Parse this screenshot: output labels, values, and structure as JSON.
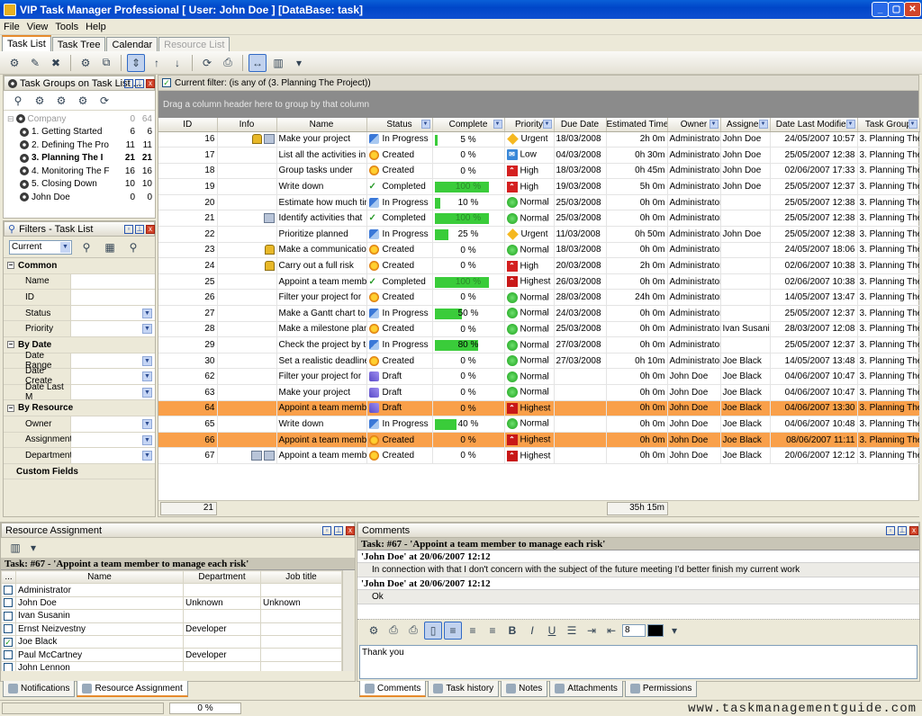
{
  "window": {
    "title": "VIP Task Manager Professional [ User: John Doe ] [DataBase: task]"
  },
  "menu": [
    "File",
    "View",
    "Tools",
    "Help"
  ],
  "tabs": [
    {
      "label": "Task List",
      "active": true
    },
    {
      "label": "Task Tree"
    },
    {
      "label": "Calendar"
    },
    {
      "label": "Resource List",
      "disabled": true
    }
  ],
  "task_groups": {
    "title": "Task Groups on Task List ...",
    "items": [
      {
        "label": "Company",
        "n1": "0",
        "n2": "64",
        "muted": true
      },
      {
        "label": "1. Getting Started",
        "n1": "6",
        "n2": "6"
      },
      {
        "label": "2. Defining The Pro",
        "n1": "11",
        "n2": "11"
      },
      {
        "label": "3. Planning The I",
        "n1": "21",
        "n2": "21",
        "bold": true
      },
      {
        "label": "4. Monitoring The F",
        "n1": "16",
        "n2": "16"
      },
      {
        "label": "5. Closing Down",
        "n1": "10",
        "n2": "10"
      },
      {
        "label": "John Doe",
        "n1": "0",
        "n2": "0"
      }
    ]
  },
  "filters": {
    "title": "Filters - Task List",
    "preset": "Current",
    "groups": [
      {
        "name": "Common",
        "rows": [
          {
            "label": "Name",
            "dd": false
          },
          {
            "label": "ID",
            "dd": false
          },
          {
            "label": "Status",
            "dd": true
          },
          {
            "label": "Priority",
            "dd": true
          }
        ]
      },
      {
        "name": "By Date",
        "rows": [
          {
            "label": "Date Range",
            "dd": true
          },
          {
            "label": "Date Create",
            "dd": true
          },
          {
            "label": "Date Last M",
            "dd": true
          }
        ]
      },
      {
        "name": "By Resource",
        "rows": [
          {
            "label": "Owner",
            "dd": true
          },
          {
            "label": "Assignment",
            "dd": true
          },
          {
            "label": "Department",
            "dd": true
          }
        ]
      }
    ],
    "custom_fields": "Custom Fields"
  },
  "grid": {
    "filter_text": "Current filter:  (is any of (3. Planning The Project))",
    "groupby_hint": "Drag a column header here to group by that column",
    "columns": [
      "ID",
      "Info",
      "Name",
      "Status",
      "Complete",
      "Priority",
      "Due Date",
      "Estimated Time",
      "Owner",
      "Assigned",
      "Date Last Modified",
      "Task Group"
    ],
    "rows": [
      {
        "id": "16",
        "info": [
          "lock",
          "att"
        ],
        "name": "Make your project",
        "status": "In Progress",
        "st": "prog",
        "pct": 5,
        "complete": "5 %",
        "priority": "Urgent",
        "pr": "urgent",
        "due": "18/03/2008",
        "est": "2h 0m",
        "owner": "Administrator",
        "assigned": "John Doe",
        "mod": "24/05/2007 10:57",
        "group": "3. Planning The"
      },
      {
        "id": "17",
        "info": [],
        "name": "List all the activities in",
        "status": "Created",
        "st": "created",
        "pct": 0,
        "complete": "0 %",
        "priority": "Low",
        "pr": "low",
        "due": "04/03/2008",
        "est": "0h 30m",
        "owner": "Administrator",
        "assigned": "John Doe",
        "mod": "25/05/2007 12:38",
        "group": "3. Planning The"
      },
      {
        "id": "18",
        "info": [],
        "name": "Group tasks under",
        "status": "Created",
        "st": "created",
        "pct": 0,
        "complete": "0 %",
        "priority": "High",
        "pr": "high",
        "due": "18/03/2008",
        "est": "0h 45m",
        "owner": "Administrator",
        "assigned": "John Doe",
        "mod": "02/06/2007 17:33",
        "group": "3. Planning The"
      },
      {
        "id": "19",
        "info": [],
        "name": "Write down",
        "status": "Completed",
        "st": "done",
        "pct": 100,
        "complete": "100 %",
        "priority": "High",
        "pr": "high",
        "due": "19/03/2008",
        "est": "5h 0m",
        "owner": "Administrator",
        "assigned": "John Doe",
        "mod": "25/05/2007 12:37",
        "group": "3. Planning The"
      },
      {
        "id": "20",
        "info": [],
        "name": "Estimate how much time",
        "status": "In Progress",
        "st": "prog",
        "pct": 10,
        "complete": "10 %",
        "priority": "Normal",
        "pr": "normal",
        "due": "25/03/2008",
        "est": "0h 0m",
        "owner": "Administrator",
        "assigned": "",
        "mod": "25/05/2007 12:38",
        "group": "3. Planning The"
      },
      {
        "id": "21",
        "info": [
          "att"
        ],
        "name": "Identify activities that",
        "status": "Completed",
        "st": "done",
        "pct": 100,
        "complete": "100 %",
        "priority": "Normal",
        "pr": "normal",
        "due": "25/03/2008",
        "est": "0h 0m",
        "owner": "Administrator",
        "assigned": "",
        "mod": "25/05/2007 12:38",
        "group": "3. Planning The"
      },
      {
        "id": "22",
        "info": [],
        "name": "Prioritize planned",
        "status": "In Progress",
        "st": "prog",
        "pct": 25,
        "complete": "25 %",
        "priority": "Urgent",
        "pr": "urgent",
        "due": "11/03/2008",
        "est": "0h 50m",
        "owner": "Administrator",
        "assigned": "John Doe",
        "mod": "25/05/2007 12:38",
        "group": "3. Planning The"
      },
      {
        "id": "23",
        "info": [
          "lock"
        ],
        "name": "Make a communication",
        "status": "Created",
        "st": "created",
        "pct": 0,
        "complete": "0 %",
        "priority": "Normal",
        "pr": "normal",
        "due": "18/03/2008",
        "est": "0h 0m",
        "owner": "Administrator",
        "assigned": "",
        "mod": "24/05/2007 18:06",
        "group": "3. Planning The"
      },
      {
        "id": "24",
        "info": [
          "lock"
        ],
        "name": "Carry out a full risk",
        "status": "Created",
        "st": "created",
        "pct": 0,
        "complete": "0 %",
        "priority": "High",
        "pr": "high",
        "due": "20/03/2008",
        "est": "2h 0m",
        "owner": "Administrator",
        "assigned": "",
        "mod": "02/06/2007 10:38",
        "group": "3. Planning The"
      },
      {
        "id": "25",
        "info": [],
        "name": "Appoint a team member",
        "status": "Completed",
        "st": "done",
        "pct": 100,
        "complete": "100 %",
        "priority": "Highest",
        "pr": "highest",
        "due": "26/03/2008",
        "est": "0h 0m",
        "owner": "Administrator",
        "assigned": "",
        "mod": "02/06/2007 10:38",
        "group": "3. Planning The"
      },
      {
        "id": "26",
        "info": [],
        "name": "Filter your project for",
        "status": "Created",
        "st": "created",
        "pct": 0,
        "complete": "0 %",
        "priority": "Normal",
        "pr": "normal",
        "due": "28/03/2008",
        "est": "24h 0m",
        "owner": "Administrator",
        "assigned": "",
        "mod": "14/05/2007 13:47",
        "group": "3. Planning The"
      },
      {
        "id": "27",
        "info": [],
        "name": "Make a Gantt chart to",
        "status": "In Progress",
        "st": "prog",
        "pct": 50,
        "complete": "50 %",
        "priority": "Normal",
        "pr": "normal",
        "due": "24/03/2008",
        "est": "0h 0m",
        "owner": "Administrator",
        "assigned": "",
        "mod": "25/05/2007 12:37",
        "group": "3. Planning The"
      },
      {
        "id": "28",
        "info": [],
        "name": "Make a milestone plan",
        "status": "Created",
        "st": "created",
        "pct": 0,
        "complete": "0 %",
        "priority": "Normal",
        "pr": "normal",
        "due": "25/03/2008",
        "est": "0h 0m",
        "owner": "Administrator",
        "assigned": "Ivan Susanin",
        "mod": "28/03/2007 12:08",
        "group": "3. Planning The"
      },
      {
        "id": "29",
        "info": [],
        "name": "Check the project by the",
        "status": "In Progress",
        "st": "prog",
        "pct": 80,
        "complete": "80 %",
        "priority": "Normal",
        "pr": "normal",
        "due": "27/03/2008",
        "est": "0h 0m",
        "owner": "Administrator",
        "assigned": "",
        "mod": "25/05/2007 12:37",
        "group": "3. Planning The"
      },
      {
        "id": "30",
        "info": [],
        "name": "Set a realistic deadline",
        "status": "Created",
        "st": "created",
        "pct": 0,
        "complete": "0 %",
        "priority": "Normal",
        "pr": "normal",
        "due": "27/03/2008",
        "est": "0h 10m",
        "owner": "Administrator",
        "assigned": "Joe Black",
        "mod": "14/05/2007 13:48",
        "group": "3. Planning The"
      },
      {
        "id": "62",
        "info": [],
        "name": "Filter your project for",
        "status": "Draft",
        "st": "draft",
        "pct": 0,
        "complete": "0 %",
        "priority": "Normal",
        "pr": "normal",
        "due": "",
        "est": "0h 0m",
        "owner": "John Doe",
        "assigned": "Joe Black",
        "mod": "04/06/2007 10:47",
        "group": "3. Planning The"
      },
      {
        "id": "63",
        "info": [],
        "name": "Make your project",
        "status": "Draft",
        "st": "draft",
        "pct": 0,
        "complete": "0 %",
        "priority": "Normal",
        "pr": "normal",
        "due": "",
        "est": "0h 0m",
        "owner": "John Doe",
        "assigned": "Joe Black",
        "mod": "04/06/2007 10:47",
        "group": "3. Planning The"
      },
      {
        "id": "64",
        "info": [],
        "name": "Appoint a team member",
        "status": "Draft",
        "st": "draft",
        "pct": 0,
        "complete": "0 %",
        "priority": "Highest",
        "pr": "highest",
        "due": "",
        "est": "0h 0m",
        "owner": "John Doe",
        "assigned": "Joe Black",
        "mod": "04/06/2007 13:30",
        "group": "3. Planning The",
        "hl": true
      },
      {
        "id": "65",
        "info": [],
        "name": "Write down",
        "status": "In Progress",
        "st": "prog",
        "pct": 40,
        "complete": "40 %",
        "priority": "Normal",
        "pr": "normal",
        "due": "",
        "est": "0h 0m",
        "owner": "John Doe",
        "assigned": "Joe Black",
        "mod": "04/06/2007 10:48",
        "group": "3. Planning The"
      },
      {
        "id": "66",
        "info": [],
        "name": "Appoint a team member",
        "status": "Created",
        "st": "created",
        "pct": 0,
        "complete": "0 %",
        "priority": "Highest",
        "pr": "highest",
        "due": "",
        "est": "0h 0m",
        "owner": "John Doe",
        "assigned": "Joe Black",
        "mod": "08/06/2007 11:11",
        "group": "3. Planning The",
        "hl": true
      },
      {
        "id": "67",
        "info": [
          "att",
          "att"
        ],
        "name": "Appoint a team member",
        "status": "Created",
        "st": "created",
        "pct": 0,
        "complete": "0 %",
        "priority": "Highest",
        "pr": "highest",
        "due": "",
        "est": "0h 0m",
        "owner": "John Doe",
        "assigned": "Joe Black",
        "mod": "20/06/2007 12:12",
        "group": "3. Planning The"
      }
    ],
    "footer_count": "21",
    "footer_time": "35h 15m"
  },
  "resource_assignment": {
    "title": "Resource Assignment",
    "task": "Task: #67 - 'Appoint a team member to manage each risk'",
    "columns": [
      "...",
      "Name",
      "Department",
      "Job title"
    ],
    "rows": [
      {
        "checked": false,
        "name": "Administrator",
        "dept": "",
        "job": ""
      },
      {
        "checked": false,
        "name": "John Doe",
        "dept": "Unknown",
        "job": "Unknown"
      },
      {
        "checked": false,
        "name": "Ivan Susanin",
        "dept": "",
        "job": ""
      },
      {
        "checked": false,
        "name": "Ernst Neizvestny",
        "dept": "Developer",
        "job": ""
      },
      {
        "checked": true,
        "name": "Joe Black",
        "dept": "",
        "job": ""
      },
      {
        "checked": false,
        "name": "Paul McCartney",
        "dept": "Developer",
        "job": ""
      },
      {
        "checked": false,
        "name": "John Lennon",
        "dept": "",
        "job": ""
      }
    ],
    "tabs": [
      "Notifications",
      "Resource Assignment"
    ]
  },
  "comments": {
    "title": "Comments",
    "task": "Task: #67 - 'Appoint a team member to manage each risk'",
    "entries": [
      {
        "head": "'John Doe' at 20/06/2007 12:12",
        "body": "In connection with that I don't concern with the subject of the future meeting I'd better finish my current work"
      },
      {
        "head": "'John Doe' at 20/06/2007 12:12",
        "body": "Ok"
      }
    ],
    "font_size": "8",
    "editor_text": "Thank you",
    "tabs": [
      "Comments",
      "Task history",
      "Notes",
      "Attachments",
      "Permissions"
    ]
  },
  "status": {
    "progress": "0 %",
    "watermark": "www.taskmanagementguide.com"
  },
  "colors": {
    "highlight_row": "#f9a04a",
    "progress_green": "#3acc3a",
    "titlebar": "#0a5fd8"
  }
}
